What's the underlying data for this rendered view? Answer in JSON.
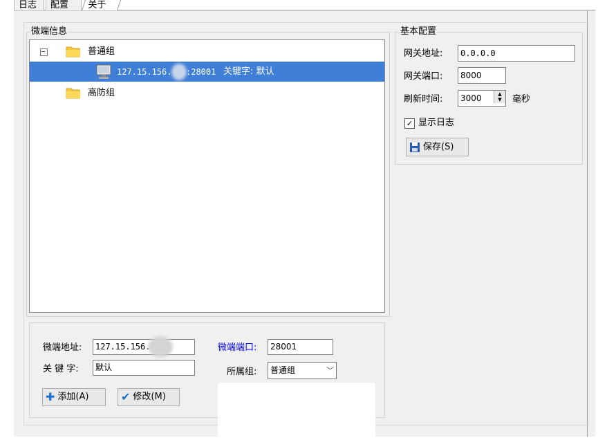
{
  "tabs": [
    {
      "label": "日志"
    },
    {
      "label": "配置"
    },
    {
      "label": "关于"
    }
  ],
  "client_info": {
    "title": "微端信息",
    "tree": [
      {
        "label": "普通组",
        "expanded": true,
        "icon": "folder-icon",
        "children": [
          {
            "ip": "127.15.156.",
            "port_text": ":28001",
            "keyword_text": "关键字: 默认",
            "icon": "computer-icon",
            "selected": true
          }
        ]
      },
      {
        "label": "高防组",
        "icon": "folder-icon"
      }
    ]
  },
  "form": {
    "address_label": "微端地址:",
    "address_value": "127.15.156.",
    "port_label": "微端端口:",
    "port_value": "28001",
    "keyword_label": "关 键 字:",
    "keyword_value": "默认",
    "group_label": "所属组:",
    "group_value": "普通组",
    "add_button": "添加(A)",
    "modify_button": "修改(M)",
    "port_label_color": "#0000ff"
  },
  "basic_config": {
    "title": "基本配置",
    "gateway_addr_label": "网关地址:",
    "gateway_addr_value": "0.0.0.0",
    "gateway_port_label": "网关端口:",
    "gateway_port_value": "8000",
    "refresh_label": "刷新时间:",
    "refresh_value": "3000",
    "refresh_unit": "毫秒",
    "show_log_label": "显示日志",
    "show_log_checked": true,
    "save_button": "保存(S)"
  },
  "colors": {
    "selection": "#3f7fd8",
    "folder": "#f5c842",
    "save_icon": "#2a5db0",
    "add_icon": "#1e6fd6",
    "check_icon": "#1e6fd6"
  }
}
